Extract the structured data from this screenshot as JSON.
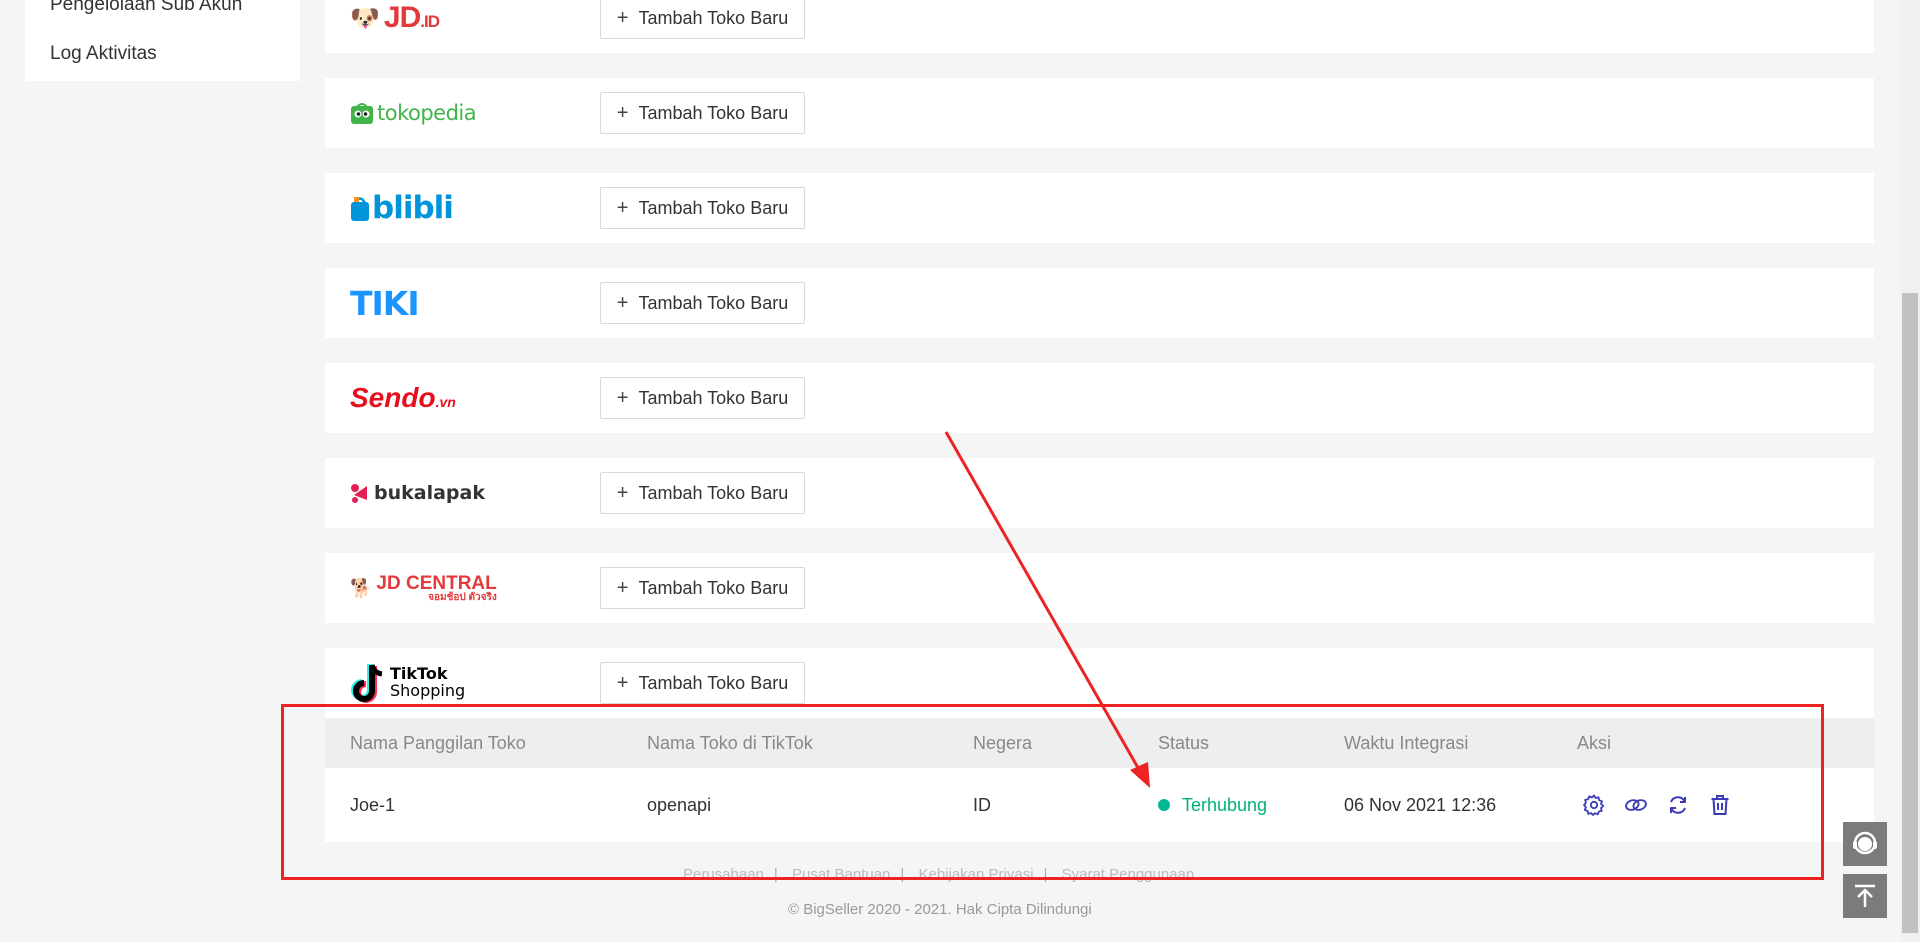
{
  "sidebar": {
    "items": [
      {
        "label": "Pengelolaan Sub Akun"
      },
      {
        "label": "Log Aktivitas"
      }
    ]
  },
  "platforms": [
    {
      "logo_text": "JD",
      "logo_suffix": ".ID",
      "button": "Tambah Toko Baru"
    },
    {
      "logo_text": "tokopedia",
      "button": "Tambah Toko Baru"
    },
    {
      "logo_text": "blibli",
      "button": "Tambah Toko Baru"
    },
    {
      "logo_text": "TIKI",
      "button": "Tambah Toko Baru"
    },
    {
      "logo_text": "Sendo",
      "logo_suffix": ".vn",
      "button": "Tambah Toko Baru"
    },
    {
      "logo_text": "bukalapak",
      "button": "Tambah Toko Baru"
    },
    {
      "logo_text": "JD CENTRAL",
      "logo_sub": "จอมช้อป ตัวจริง",
      "button": "Tambah Toko Baru"
    },
    {
      "logo_text": "TikTok",
      "logo_sub": "Shopping",
      "button": "Tambah Toko Baru"
    }
  ],
  "table": {
    "headers": [
      "Nama Panggilan Toko",
      "Nama Toko di TikTok",
      "Negera",
      "Status",
      "Waktu Integrasi",
      "Aksi"
    ],
    "row": {
      "nickname": "Joe-1",
      "tiktok_name": "openapi",
      "country": "ID",
      "status": "Terhubung",
      "integrated_at": "06 Nov 2021 12:36"
    },
    "actions": [
      "settings-icon",
      "link-icon",
      "refresh-icon",
      "trash-icon"
    ]
  },
  "footer": {
    "links": [
      "Perusahaan",
      "Pusat Bantuan",
      "Kebijakan Privasi",
      "Syarat Penggunaan"
    ],
    "copyright": "© BigSeller 2020 - 2021. Hak Cipta Dilindungi"
  },
  "colors": {
    "status_connected": "#00b27a",
    "action_icons": "#3b3bb8",
    "annotation": "#ee2222"
  }
}
